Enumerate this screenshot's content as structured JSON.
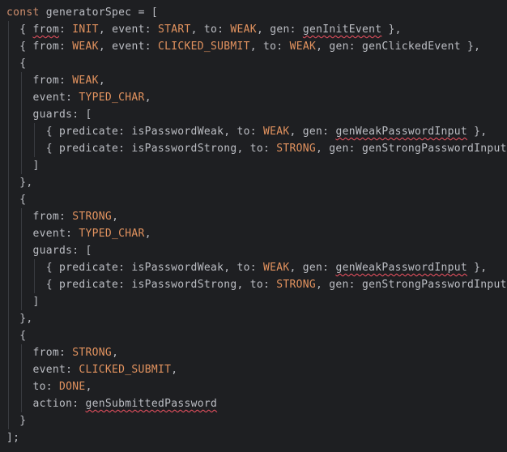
{
  "code": {
    "line1": {
      "keyword": "const",
      "name": "generatorSpec",
      "rest": " = ["
    },
    "line2": {
      "k1": "from",
      "v1": "INIT",
      "k2": "event",
      "v2": "START",
      "k3": "to",
      "v3": "WEAK",
      "k4": "gen",
      "v4": "genInitEvent"
    },
    "line3": {
      "k1": "from",
      "v1": "WEAK",
      "k2": "event",
      "v2": "CLICKED_SUBMIT",
      "k3": "to",
      "v3": "WEAK",
      "k4": "gen",
      "v4": "genClickedEvent"
    },
    "block1": {
      "from_key": "from",
      "from_val": "WEAK",
      "event_key": "event",
      "event_val": "TYPED_CHAR",
      "guards_key": "guards",
      "g1": {
        "pk": "predicate",
        "pv": "isPasswordWeak",
        "tk": "to",
        "tv": "WEAK",
        "gk": "gen",
        "gv": "genWeakPasswordInput"
      },
      "g2": {
        "pk": "predicate",
        "pv": "isPasswordStrong",
        "tk": "to",
        "tv": "STRONG",
        "gk": "gen",
        "gv": "genStrongPasswordInput"
      }
    },
    "block2": {
      "from_key": "from",
      "from_val": "STRONG",
      "event_key": "event",
      "event_val": "TYPED_CHAR",
      "guards_key": "guards",
      "g1": {
        "pk": "predicate",
        "pv": "isPasswordWeak",
        "tk": "to",
        "tv": "WEAK",
        "gk": "gen",
        "gv": "genWeakPasswordInput"
      },
      "g2": {
        "pk": "predicate",
        "pv": "isPasswordStrong",
        "tk": "to",
        "tv": "STRONG",
        "gk": "gen",
        "gv": "genStrongPasswordInput"
      }
    },
    "block3": {
      "from_key": "from",
      "from_val": "STRONG",
      "event_key": "event",
      "event_val": "CLICKED_SUBMIT",
      "to_key": "to",
      "to_val": "DONE",
      "action_key": "action",
      "action_val": "genSubmittedPassword"
    },
    "end": "];"
  },
  "colors": {
    "background": "#1e1f22",
    "keyword": "#cf8e6d",
    "constant": "#e3935f",
    "property": "#c7a0d8",
    "text": "#bcbec4",
    "indent_guide": "#393b40",
    "squiggle": "#f75464"
  }
}
